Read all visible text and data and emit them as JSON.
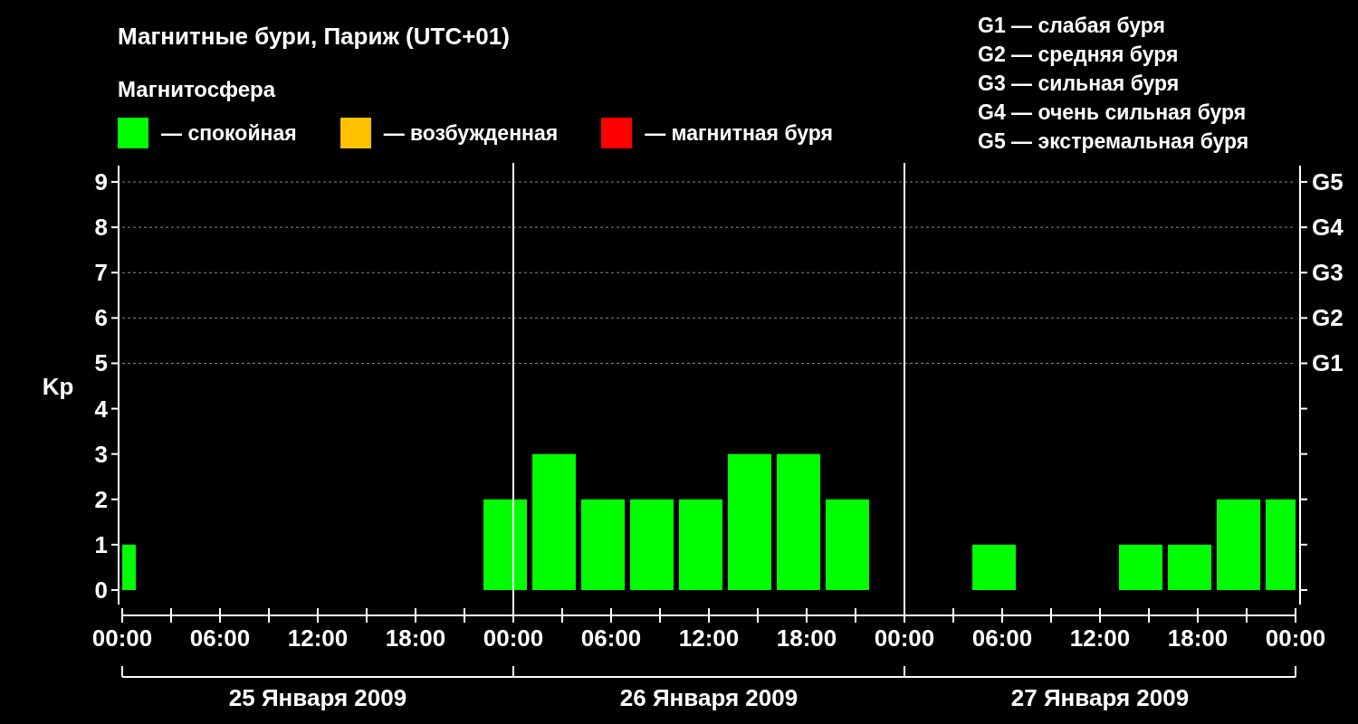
{
  "title": "Магнитные бури, Париж (UTC+01)",
  "legend": {
    "title": "Магнитосфера",
    "items": [
      {
        "label": "— спокойная",
        "color": "#00ff00"
      },
      {
        "label": "— возбужденная",
        "color": "#ffc000"
      },
      {
        "label": "— магнитная буря",
        "color": "#ff0000"
      }
    ]
  },
  "g_scale": [
    "G1 — слабая буря",
    "G2 — средняя буря",
    "G3 — сильная буря",
    "G4 — очень сильная буря",
    "G5 — экстремальная буря"
  ],
  "chart": {
    "chart_data": {
      "type": "bar",
      "grid": true,
      "x": [
        "2009-01-25T00:30",
        "2009-01-25T02:30",
        "2009-01-25T05:30",
        "2009-01-25T08:30",
        "2009-01-25T11:30",
        "2009-01-25T14:30",
        "2009-01-25T17:30",
        "2009-01-25T20:30",
        "2009-01-25T23:30",
        "2009-01-26T02:30",
        "2009-01-26T05:30",
        "2009-01-26T08:30",
        "2009-01-26T11:30",
        "2009-01-26T14:30",
        "2009-01-26T17:30",
        "2009-01-26T20:30",
        "2009-01-26T23:30",
        "2009-01-27T02:30",
        "2009-01-27T05:30",
        "2009-01-27T08:30",
        "2009-01-27T11:30",
        "2009-01-27T14:30",
        "2009-01-27T17:30",
        "2009-01-27T20:30",
        "2009-01-27T23:00"
      ],
      "series": [
        {
          "name": "Kp",
          "values": [
            1,
            null,
            null,
            null,
            null,
            null,
            null,
            null,
            2,
            3,
            2,
            2,
            2,
            3,
            3,
            2,
            null,
            null,
            1,
            null,
            null,
            1,
            1,
            2,
            2
          ]
        }
      ],
      "xlim": [
        "2009-01-25T00:00",
        "2009-01-28T00:00"
      ],
      "ylim": [
        -0.32,
        9.36
      ],
      "xticks": [
        {
          "value": "2009-01-25T00:00",
          "label": "00:00"
        },
        {
          "value": "2009-01-25T06:00",
          "label": "06:00"
        },
        {
          "value": "2009-01-25T12:00",
          "label": "12:00"
        },
        {
          "value": "2009-01-25T18:00",
          "label": "18:00"
        },
        {
          "value": "2009-01-26T00:00",
          "label": "00:00"
        },
        {
          "value": "2009-01-26T06:00",
          "label": "06:00"
        },
        {
          "value": "2009-01-26T12:00",
          "label": "12:00"
        },
        {
          "value": "2009-01-26T18:00",
          "label": "18:00"
        },
        {
          "value": "2009-01-27T00:00",
          "label": "00:00"
        },
        {
          "value": "2009-01-27T06:00",
          "label": "06:00"
        },
        {
          "value": "2009-01-27T12:00",
          "label": "12:00"
        },
        {
          "value": "2009-01-27T18:00",
          "label": "18:00"
        },
        {
          "value": "2009-01-28T00:00",
          "label": "00:00"
        }
      ],
      "yticks": [
        0,
        1,
        2,
        3,
        4,
        5,
        6,
        7,
        8,
        9
      ]
    },
    "g_levels": [
      "G5",
      "G4",
      "G3",
      "G2",
      "G1"
    ],
    "days": [
      "25 Января 2009",
      "26 Января 2009",
      "27 Января 2009"
    ]
  }
}
